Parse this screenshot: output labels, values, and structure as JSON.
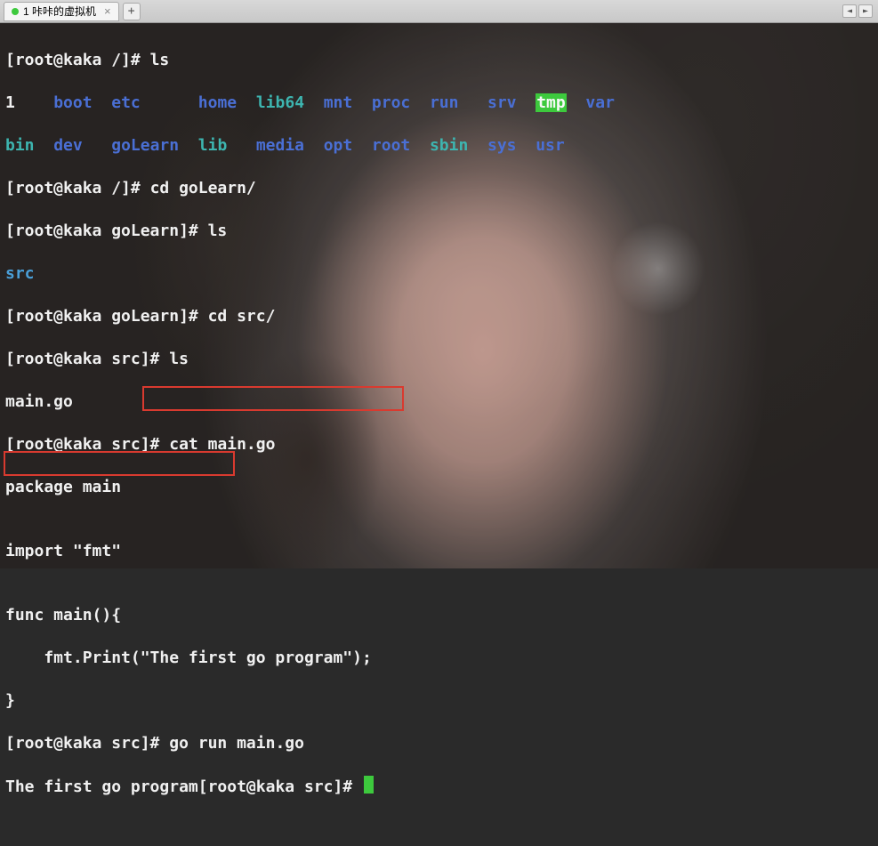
{
  "tab": {
    "title": "1 咔咔的虚拟机",
    "close_glyph": "×",
    "add_glyph": "+",
    "scroll_left": "◄",
    "scroll_right": "►"
  },
  "prompts": {
    "root_slash": "[root@kaka /]# ",
    "root_golearn": "[root@kaka goLearn]# ",
    "root_src": "[root@kaka src]# "
  },
  "commands": {
    "ls": "ls",
    "cd_golearn": "cd goLearn/",
    "cd_src": "cd src/",
    "cat_main": "cat main.go",
    "go_run": "go run main.go"
  },
  "ls_root": {
    "c1_1": "1",
    "c1_boot": "boot",
    "c1_etc": "etc",
    "c1_home": "home",
    "c1_lib64": "lib64",
    "c1_mnt": "mnt",
    "c1_proc": "proc",
    "c1_run": "run",
    "c1_srv": "srv",
    "c1_tmp": "tmp",
    "c1_var": "var",
    "c2_bin": "bin",
    "c2_dev": "dev",
    "c2_golearn": "goLearn",
    "c2_lib": "lib",
    "c2_media": "media",
    "c2_opt": "opt",
    "c2_root": "root",
    "c2_sbin": "sbin",
    "c2_sys": "sys",
    "c2_usr": "usr"
  },
  "ls_golearn": {
    "src": "src"
  },
  "ls_src": {
    "main": "main.go"
  },
  "source": {
    "l1": "package main",
    "l2": "",
    "l3": "import \"fmt\"",
    "l4": "",
    "l5": "func main(){",
    "l6": "    fmt.Print(\"The first go program\");",
    "l7": "}"
  },
  "output": {
    "run_out": "The first go program"
  }
}
